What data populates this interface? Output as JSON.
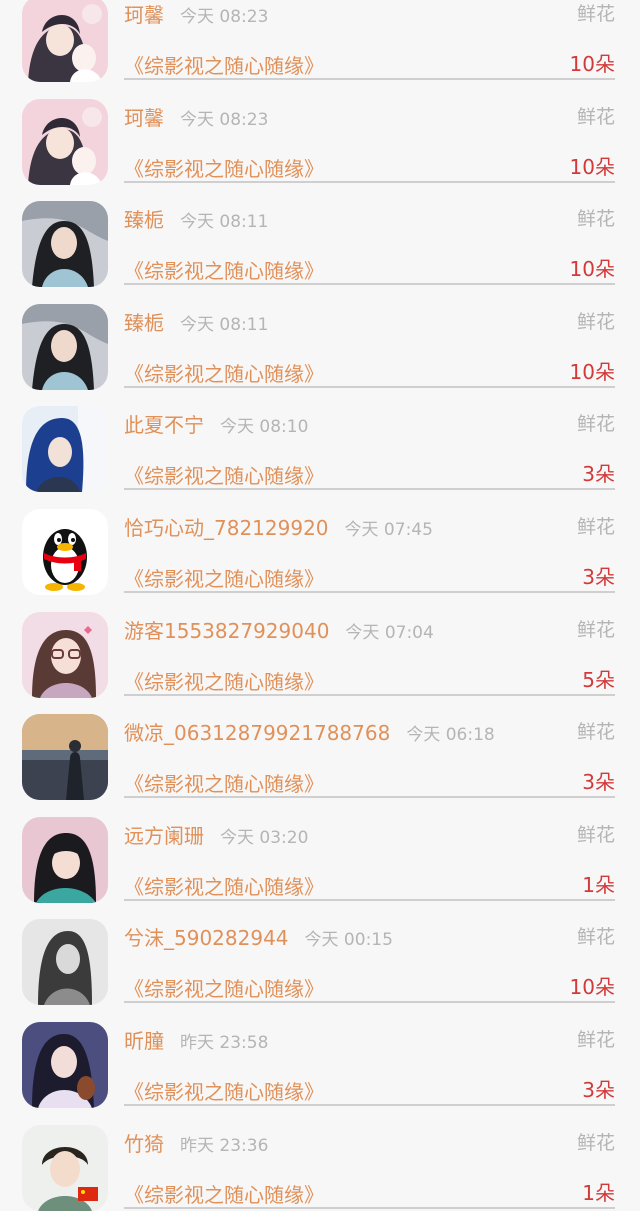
{
  "gift_list": {
    "items": [
      {
        "name": "珂馨",
        "time": "今天 08:23",
        "gift_type": "鲜花",
        "book": "《综影视之随心随缘》",
        "count": "10朵",
        "avatar": "anime-couple-avatar"
      },
      {
        "name": "珂馨",
        "time": "今天 08:23",
        "gift_type": "鲜花",
        "book": "《综影视之随心随缘》",
        "count": "10朵",
        "avatar": "anime-couple-avatar"
      },
      {
        "name": "臻栀",
        "time": "今天 08:11",
        "gift_type": "鲜花",
        "book": "《综影视之随心随缘》",
        "count": "10朵",
        "avatar": "costume-lady-avatar"
      },
      {
        "name": "臻栀",
        "time": "今天 08:11",
        "gift_type": "鲜花",
        "book": "《综影视之随心随缘》",
        "count": "10朵",
        "avatar": "costume-lady-avatar"
      },
      {
        "name": "此夏不宁",
        "time": "今天 08:10",
        "gift_type": "鲜花",
        "book": "《综影视之随心随缘》",
        "count": "3朵",
        "avatar": "anime-boy-avatar"
      },
      {
        "name": "恰巧心动_782129920",
        "time": "今天 07:45",
        "gift_type": "鲜花",
        "book": "《综影视之随心随缘》",
        "count": "3朵",
        "avatar": "penguin-avatar"
      },
      {
        "name": "游客1553827929040",
        "time": "今天 07:04",
        "gift_type": "鲜花",
        "book": "《综影视之随心随缘》",
        "count": "5朵",
        "avatar": "girl-glasses-avatar"
      },
      {
        "name": "微凉_06312879921788768",
        "time": "今天 06:18",
        "gift_type": "鲜花",
        "book": "《综影视之随心随缘》",
        "count": "3朵",
        "avatar": "sunset-beach-avatar"
      },
      {
        "name": "远方阑珊",
        "time": "今天 03:20",
        "gift_type": "鲜花",
        "book": "《综影视之随心随缘》",
        "count": "1朵",
        "avatar": "girl-bangs-avatar"
      },
      {
        "name": "兮沫_590282944",
        "time": "今天 00:15",
        "gift_type": "鲜花",
        "book": "《综影视之随心随缘》",
        "count": "10朵",
        "avatar": "grey-portrait-avatar"
      },
      {
        "name": "昕朣",
        "time": "昨天 23:58",
        "gift_type": "鲜花",
        "book": "《综影视之随心随缘》",
        "count": "3朵",
        "avatar": "violin-girl-avatar"
      },
      {
        "name": "竹猗",
        "time": "昨天 23:36",
        "gift_type": "鲜花",
        "book": "《综影视之随心随缘》",
        "count": "1朵",
        "avatar": "young-man-flag-avatar"
      }
    ]
  }
}
